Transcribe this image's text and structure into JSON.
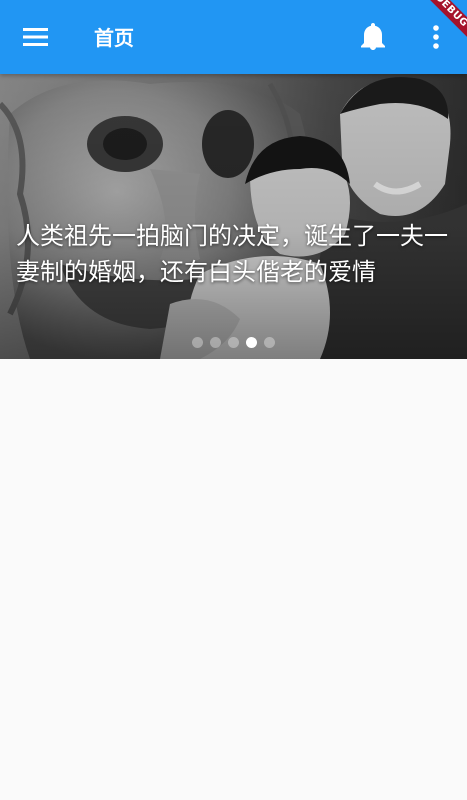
{
  "appbar": {
    "title": "首页",
    "color": "#2196f3",
    "menu_icon": "menu-icon",
    "notification_icon": "bell-icon",
    "more_icon": "more-vert-icon"
  },
  "debug_banner": {
    "label": "DEBUG",
    "color": "#a5122b"
  },
  "carousel": {
    "caption": "人类祖先一拍脑门的决定，诞生了一夫一妻制的婚姻，还有白头偕老的爱情",
    "page_count": 5,
    "active_index": 3
  }
}
